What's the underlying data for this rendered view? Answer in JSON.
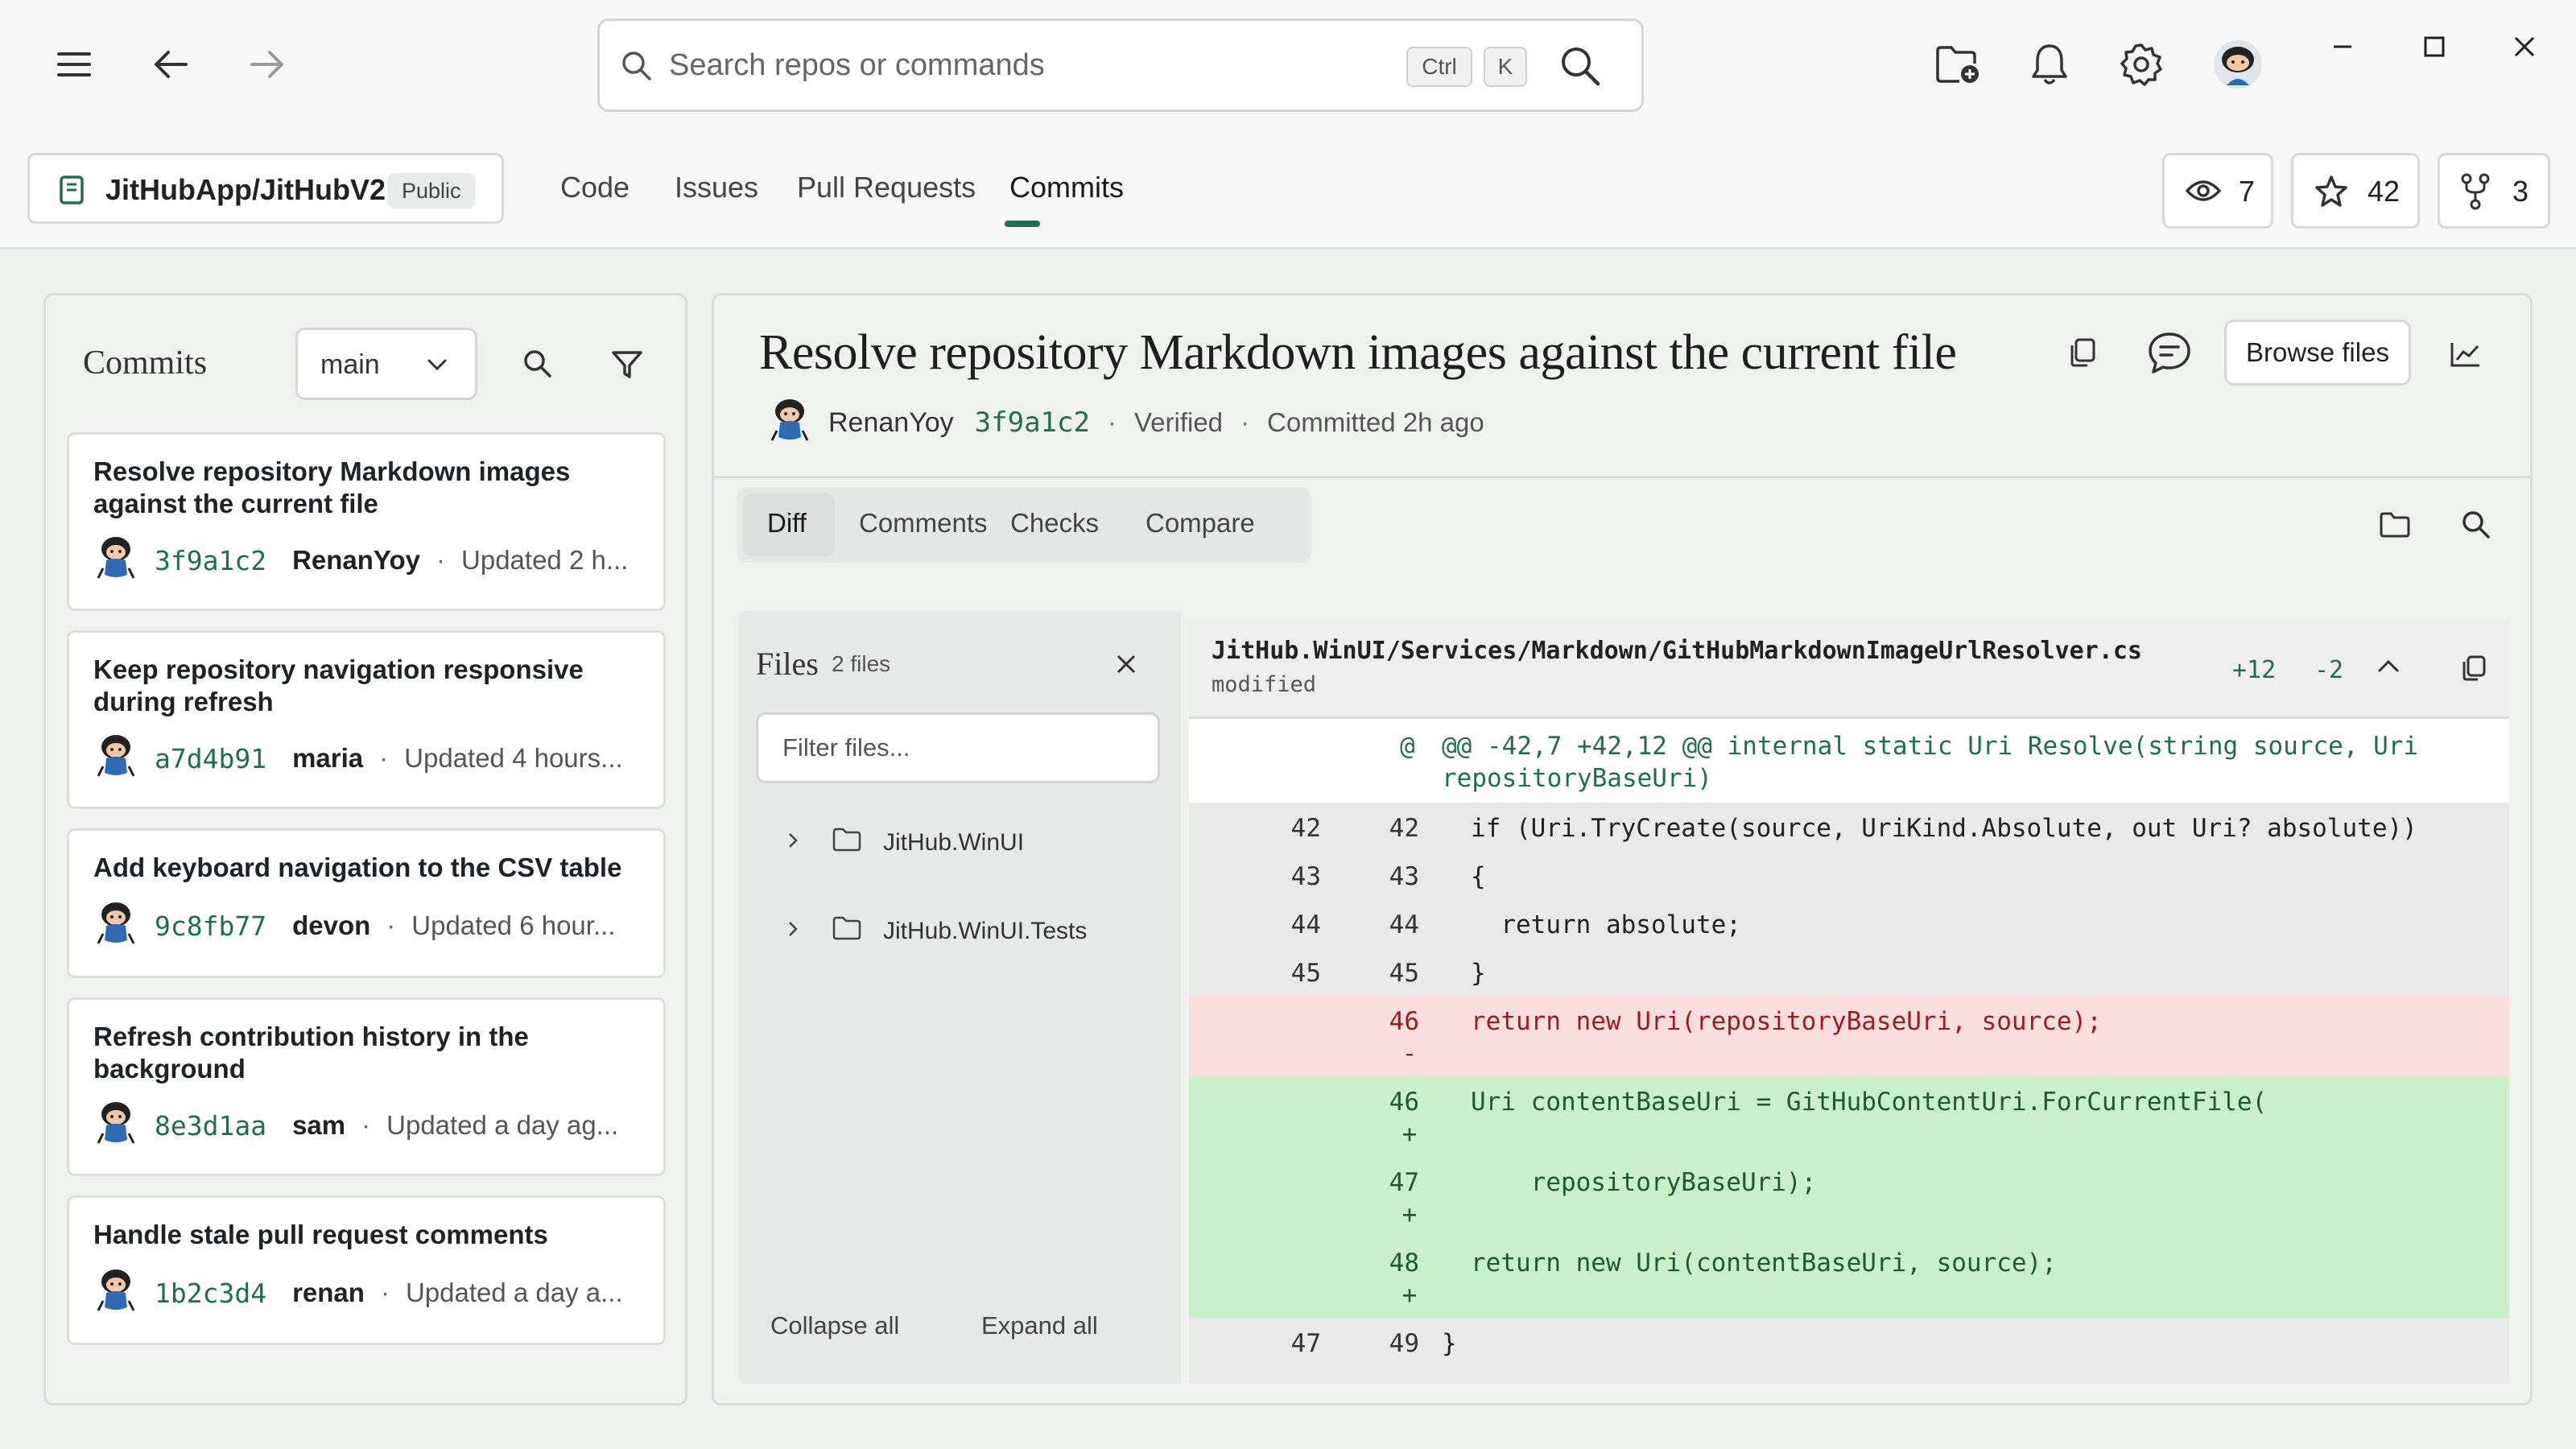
{
  "titlebar": {
    "search_placeholder": "Search repos or commands",
    "shortcut_ctrl": "Ctrl",
    "shortcut_key": "K"
  },
  "repo": {
    "name": "JitHubApp/JitHubV2",
    "visibility": "Public",
    "tabs": [
      {
        "label": "Code"
      },
      {
        "label": "Issues"
      },
      {
        "label": "Pull Requests"
      },
      {
        "label": "Commits"
      }
    ],
    "active_tab": "Commits",
    "watchers": "7",
    "stars": "42",
    "forks": "3"
  },
  "commits_panel": {
    "title": "Commits",
    "branch": "main",
    "items": [
      {
        "title": "Resolve repository Markdown images against the current file",
        "sha": "3f9a1c2",
        "author": "RenanYoy",
        "updated": "Updated 2 h..."
      },
      {
        "title": "Keep repository navigation responsive during refresh",
        "sha": "a7d4b91",
        "author": "maria",
        "updated": "Updated 4 hours..."
      },
      {
        "title": "Add keyboard navigation to the CSV table",
        "sha": "9c8fb77",
        "author": "devon",
        "updated": "Updated 6 hour..."
      },
      {
        "title": "Refresh contribution history in the background",
        "sha": "8e3d1aa",
        "author": "sam",
        "updated": "Updated a day ag..."
      },
      {
        "title": "Handle stale pull request comments",
        "sha": "1b2c3d4",
        "author": "renan",
        "updated": "Updated a day a..."
      }
    ]
  },
  "commit_detail": {
    "title": "Resolve repository Markdown images against the current file",
    "author": "RenanYoy",
    "sha": "3f9a1c2",
    "verified": "Verified",
    "committed": "Committed 2h ago",
    "browse_files": "Browse files",
    "subtabs": [
      {
        "label": "Diff"
      },
      {
        "label": "Comments"
      },
      {
        "label": "Checks"
      },
      {
        "label": "Compare"
      }
    ]
  },
  "files": {
    "title": "Files",
    "count": "2 files",
    "filter_placeholder": "Filter files...",
    "tree": [
      {
        "label": "JitHub.WinUI"
      },
      {
        "label": "JitHub.WinUI.Tests"
      }
    ],
    "collapse_all": "Collapse all",
    "expand_all": "Expand all"
  },
  "diff": {
    "path": "JitHub.WinUI/Services/Markdown/GitHubMarkdownImageUrlResolver.cs",
    "status": "modified",
    "additions": "+12",
    "deletions": "-2",
    "hunk_sign": "@",
    "hunk_line1": "@@ -42,7 +42,12 @@ internal static Uri Resolve(string source, Uri",
    "hunk_line2": "repositoryBaseUri)",
    "lines": [
      {
        "old": "42",
        "new": "42",
        "sign": "",
        "code": "if (Uri.TryCreate(source, UriKind.Absolute, out Uri? absolute))",
        "type": "ctx"
      },
      {
        "old": "43",
        "new": "43",
        "sign": "",
        "code": "{",
        "type": "ctx"
      },
      {
        "old": "44",
        "new": "44",
        "sign": "",
        "code": "  return absolute;",
        "type": "ctx"
      },
      {
        "old": "45",
        "new": "45",
        "sign": "",
        "code": "}",
        "type": "ctx"
      },
      {
        "old": "",
        "new": "46",
        "sign": "-",
        "code": "return new Uri(repositoryBaseUri, source);",
        "type": "del"
      },
      {
        "old": "",
        "new": "46",
        "sign": "+",
        "code": "Uri contentBaseUri = GitHubContentUri.ForCurrentFile(",
        "type": "add"
      },
      {
        "old": "",
        "new": "47",
        "sign": "+",
        "code": "    repositoryBaseUri);",
        "type": "add"
      },
      {
        "old": "",
        "new": "48",
        "sign": "+",
        "code": "return new Uri(contentBaseUri, source);",
        "type": "add"
      },
      {
        "old": "47",
        "new": "49",
        "sign": "",
        "code": "}",
        "type": "ctx"
      }
    ]
  },
  "colors": {
    "accent": "#1f6e4c",
    "deleted_bg": "#fadede",
    "added_bg": "#c9f0c9"
  }
}
